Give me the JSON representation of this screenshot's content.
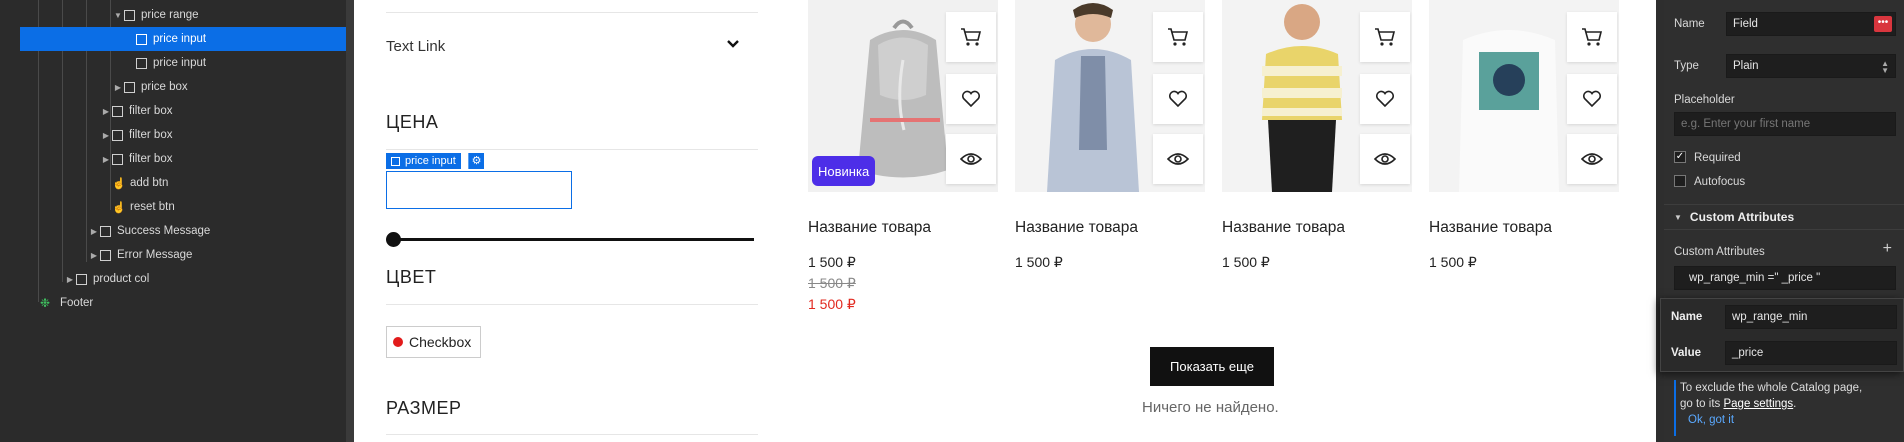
{
  "navigator": {
    "items": [
      {
        "label": "price range",
        "caret": "▼"
      },
      {
        "label": "price input",
        "caret": ""
      },
      {
        "label": "price input",
        "caret": ""
      },
      {
        "label": "price box",
        "caret": "▶"
      },
      {
        "label": "filter box",
        "caret": "▶"
      },
      {
        "label": "filter box",
        "caret": "▶"
      },
      {
        "label": "filter box",
        "caret": "▶"
      },
      {
        "label": "add btn",
        "caret": ""
      },
      {
        "label": "reset btn",
        "caret": ""
      },
      {
        "label": "Success Message",
        "caret": "▶"
      },
      {
        "label": "Error Message",
        "caret": "▶"
      },
      {
        "label": "product col",
        "caret": "▶"
      },
      {
        "label": "Footer",
        "caret": ""
      }
    ]
  },
  "filters": {
    "text_link": "Text Link",
    "price_title": "ЦЕНА",
    "selection_tag": "price input",
    "color_title": "ЦВЕТ",
    "checkbox_label": "Checkbox",
    "size_title": "РАЗМЕР"
  },
  "products": [
    {
      "title": "Название товара",
      "price": "1 500 ₽",
      "old_price": "1 500 ₽",
      "sale_price": "1 500 ₽",
      "badge": "Новинка"
    },
    {
      "title": "Название товара",
      "price": "1 500 ₽"
    },
    {
      "title": "Название товара",
      "price": "1 500 ₽"
    },
    {
      "title": "Название товара",
      "price": "1 500 ₽"
    }
  ],
  "show_more_label": "Показать еще",
  "empty_message": "Ничего не найдено.",
  "settings": {
    "name_label": "Name",
    "name_value": "Field",
    "type_label": "Type",
    "type_value": "Plain",
    "placeholder_label": "Placeholder",
    "placeholder_value": "e.g. Enter your first name",
    "required_label": "Required",
    "autofocus_label": "Autofocus",
    "section_title": "Custom Attributes",
    "custom_attrs_label": "Custom Attributes",
    "attribute_row": "wp_range_min =\" _price \"",
    "popup_name_label": "Name",
    "popup_name_value": "wp_range_min",
    "popup_value_label": "Value",
    "popup_value_value": "_price",
    "tip_text_1": "To exclude the whole Catalog page,",
    "tip_text_2": "go to its",
    "tip_link": "Page settings",
    "tip_text_3": ".",
    "ok_link": "Ok, got it"
  },
  "colors": {
    "selection_blue": "#0b6ee6",
    "badge_purple": "#4d2ee8",
    "sale_red": "#e2291f",
    "panel_dark": "#2f2f2f"
  }
}
